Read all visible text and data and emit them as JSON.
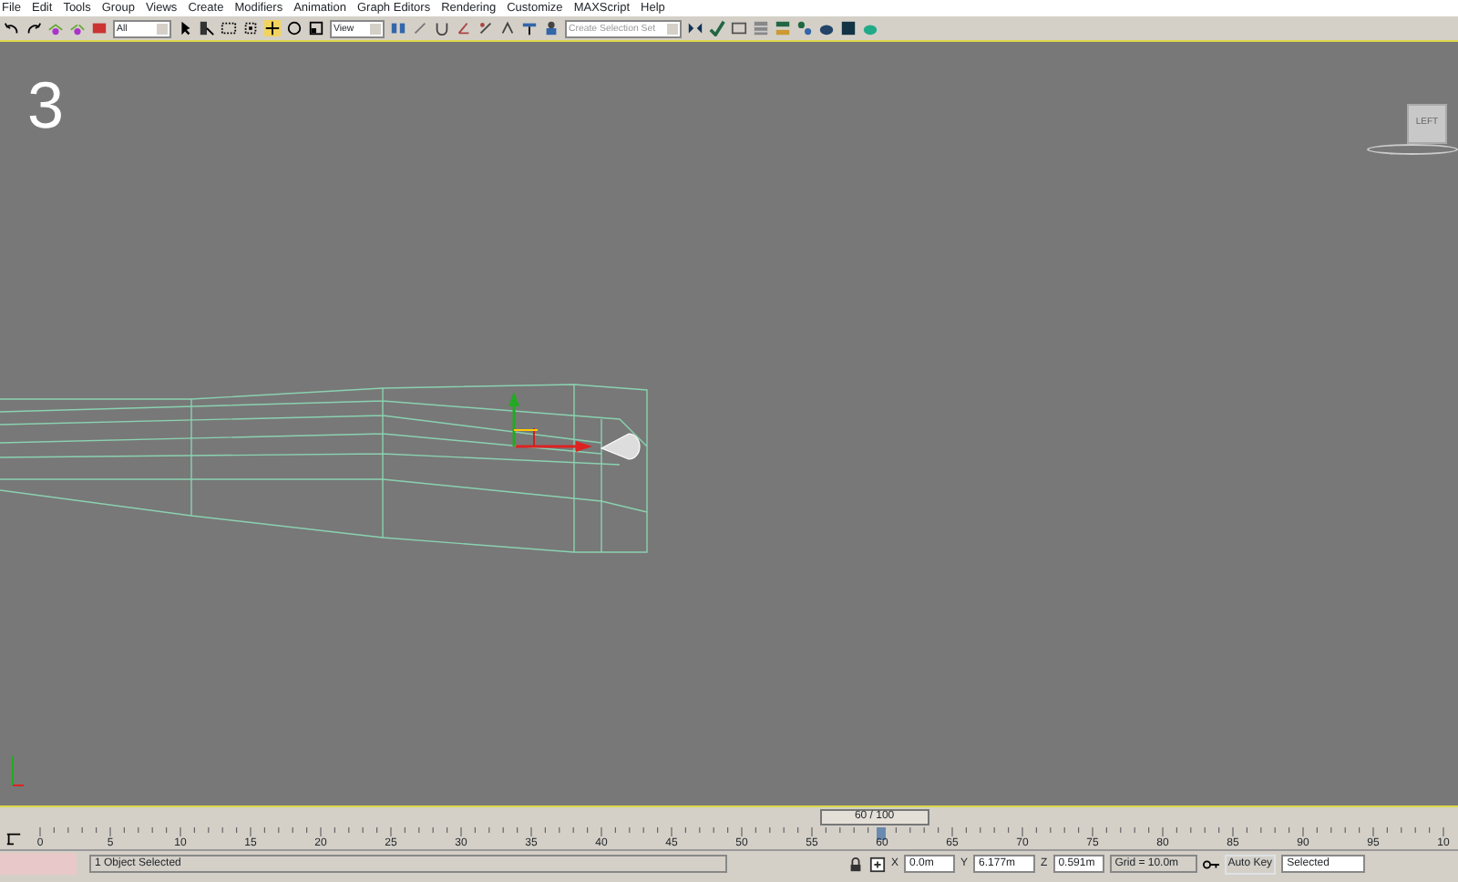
{
  "menu": [
    "File",
    "Edit",
    "Tools",
    "Group",
    "Views",
    "Create",
    "Modifiers",
    "Animation",
    "Graph Editors",
    "Rendering",
    "Customize",
    "MAXScript",
    "Help"
  ],
  "toolbar": {
    "selection_filter": "All",
    "reference_coordinate": "View",
    "selection_set": {
      "placeholder": "Create Selection Set"
    }
  },
  "viewport": {
    "label": "3",
    "viewcube": "LEFT"
  },
  "time_slider": {
    "text": "60 / 100",
    "level": 0.6
  },
  "ruler": {
    "ticks": [
      "0",
      "5",
      "10",
      "15",
      "20",
      "25",
      "30",
      "35",
      "40",
      "45",
      "50",
      "55",
      "60",
      "65",
      "70",
      "75",
      "80",
      "85",
      "90",
      "95",
      "10"
    ]
  },
  "status_bar": {
    "message": "1 Object Selected",
    "axis_labels": [
      "X",
      "Y",
      "Z"
    ],
    "x": "0.0m",
    "y": "6.177m",
    "z": "0.591m",
    "grid": "Grid = 10.0m",
    "auto_key": "Auto Key",
    "key_filter": "Selected"
  }
}
